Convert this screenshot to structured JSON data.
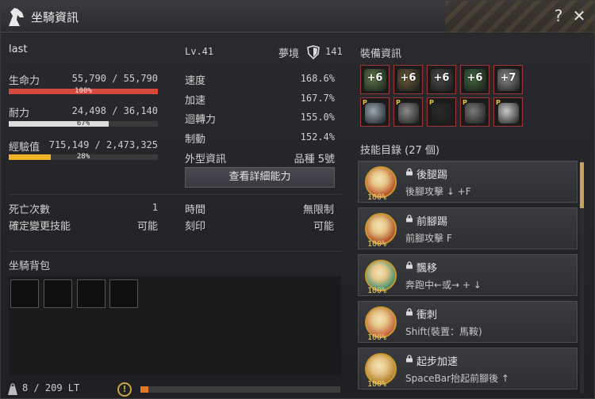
{
  "window": {
    "title": "坐騎資訊"
  },
  "mount": {
    "name": "last",
    "level": "Lv.41",
    "dream_label": "夢境",
    "dream_value": "141"
  },
  "stats": {
    "hp": {
      "label": "生命力",
      "value": "55,790 / 55,790",
      "pct_text": "100%",
      "fraction": 1.0
    },
    "stamina": {
      "label": "耐力",
      "value": "24,498 / 36,140",
      "pct_text": "67%",
      "fraction": 0.67
    },
    "exp": {
      "label": "經驗值",
      "value": "715,149 / 2,473,325",
      "pct_text": "28%",
      "fraction": 0.28
    }
  },
  "attributes": [
    {
      "label": "速度",
      "value": "168.6%"
    },
    {
      "label": "加速",
      "value": "167.7%"
    },
    {
      "label": "迴轉力",
      "value": "155.0%"
    },
    {
      "label": "制動",
      "value": "152.4%"
    },
    {
      "label": "外型資訊",
      "value": "品種 5號"
    }
  ],
  "detail_button": "查看詳細能力",
  "misc_left": [
    {
      "label": "死亡次數",
      "value": "1"
    },
    {
      "label": "確定變更技能",
      "value": "可能"
    }
  ],
  "misc_right": [
    {
      "label": "時間",
      "value": "無限制"
    },
    {
      "label": "刻印",
      "value": "可能"
    }
  ],
  "bag": {
    "title": "坐騎背包",
    "weight": "8 / 209 LT",
    "weight_fraction": 0.04
  },
  "equipment": {
    "title": "裝備資訊",
    "row1": [
      "+6",
      "+6",
      "+6",
      "+6",
      "+7"
    ],
    "row2_marker": "P"
  },
  "skills": {
    "title": "技能目錄 (27 個)",
    "items": [
      {
        "name": "後腿踢",
        "desc": "後腳攻擊 ↓ +F",
        "pct": "100%",
        "color": "#b5481f"
      },
      {
        "name": "前腳踢",
        "desc": "前腳攻擊 F",
        "pct": "100%",
        "color": "#a9461e"
      },
      {
        "name": "飄移",
        "desc": "奔跑中←或→ + ↓",
        "pct": "100%",
        "color": "#3a8a6c"
      },
      {
        "name": "衝刺",
        "desc": "Shift(裝置：馬鞍)",
        "pct": "100%",
        "color": "#c25a3a"
      },
      {
        "name": "起步加速",
        "desc": "SpaceBar抬起前腳後 ↑",
        "pct": "100%",
        "color": "#b07d2a"
      }
    ]
  },
  "colors": {
    "hp": "#d64a3d",
    "stamina": "#d9d9d9",
    "exp": "#f0b42a",
    "accent": "#c99a2e"
  }
}
